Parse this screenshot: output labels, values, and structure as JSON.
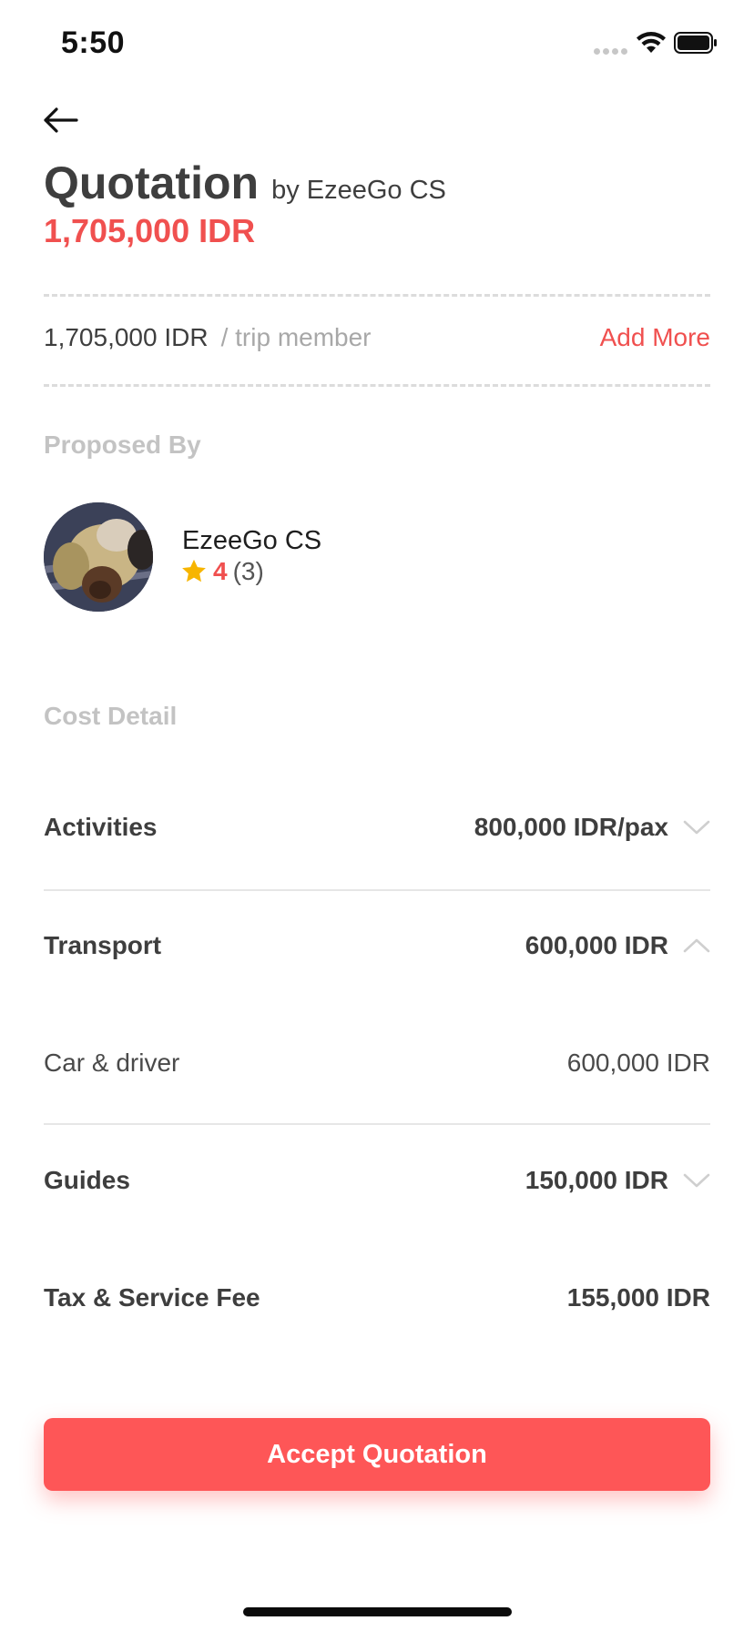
{
  "status_bar": {
    "time": "5:50"
  },
  "header": {
    "title": "Quotation",
    "by_line": "by EzeeGo CS",
    "total": "1,705,000 IDR"
  },
  "per_member": {
    "price": "1,705,000 IDR",
    "unit": "/ trip member",
    "add_more_label": "Add More"
  },
  "proposed_by": {
    "label": "Proposed By",
    "name": "EzeeGo CS",
    "rating": "4",
    "rating_count": "(3)"
  },
  "cost_detail": {
    "label": "Cost Detail",
    "items": [
      {
        "label": "Activities",
        "value": "800,000 IDR/pax",
        "expanded": false
      },
      {
        "label": "Transport",
        "value": "600,000 IDR",
        "expanded": true,
        "sub_items": [
          {
            "label": "Car & driver",
            "value": "600,000 IDR"
          }
        ]
      },
      {
        "label": "Guides",
        "value": "150,000 IDR",
        "expanded": false
      },
      {
        "label": "Tax & Service Fee",
        "value": "155,000 IDR"
      }
    ]
  },
  "accept_button_label": "Accept Quotation",
  "colors": {
    "accent": "#f0504f",
    "button": "#fe5657",
    "star": "#f7b500"
  },
  "icons": [
    "back-arrow-icon",
    "wifi-icon",
    "battery-icon",
    "star-icon",
    "chevron-down-icon",
    "chevron-up-icon"
  ]
}
